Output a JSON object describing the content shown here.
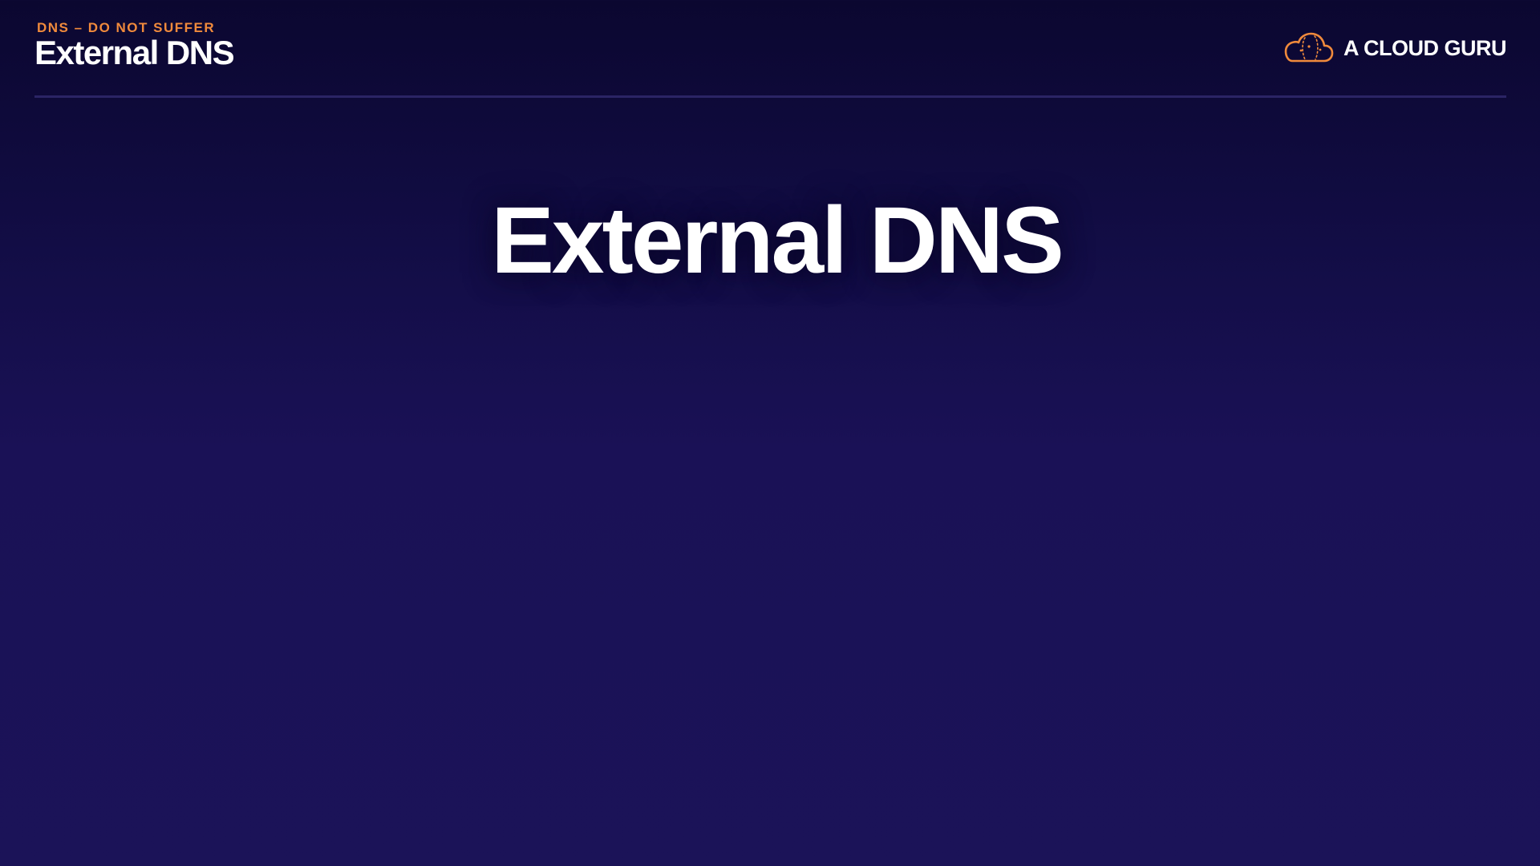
{
  "header": {
    "eyebrow": "DNS – DO NOT SUFFER",
    "title": "External DNS"
  },
  "brand": {
    "name": "A CLOUD GURU",
    "logo_icon": "cloud-icon",
    "logo_color": "#f08a3c"
  },
  "slide": {
    "title": "External DNS"
  },
  "colors": {
    "background_top": "#0b0730",
    "background_bottom": "#1b1358",
    "accent": "#f08a3c",
    "divider": "#2b2465",
    "text": "#ffffff"
  }
}
